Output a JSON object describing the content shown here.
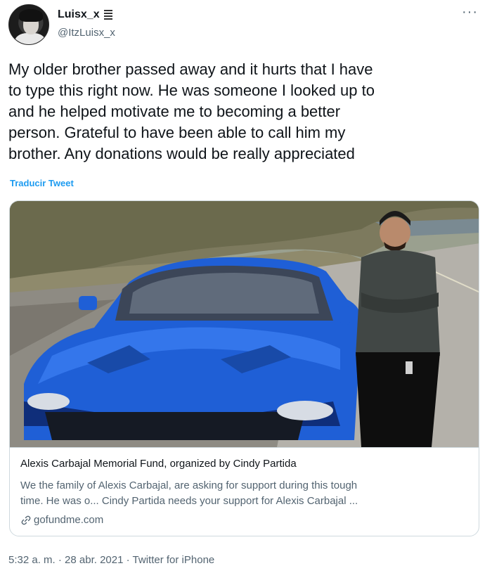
{
  "author": {
    "display_name": "Luisx_x",
    "handle": "@ItzLuisx_x"
  },
  "icons": {
    "more": "more-icon",
    "link": "link-icon"
  },
  "tweet": {
    "lines": [
      "My older brother passed away and it hurts that I have",
      "to type this right now. He was someone I looked up to",
      "and he helped motivate me to becoming a better",
      "person. Grateful to have been able to call him my",
      "brother. Any donations would be really appreciated"
    ],
    "translate_label": "Traducir Tweet"
  },
  "card": {
    "title": "Alexis Carbajal Memorial Fund, organized by Cindy Partida",
    "description_lines": [
      "We the family of Alexis Carbajal, are asking for support during this tough",
      "time. He was o... Cindy Partida needs your support for Alexis Carbajal ..."
    ],
    "domain": "gofundme.com"
  },
  "meta": {
    "time": "5:32 a. m.",
    "date": "28 abr. 2021",
    "source": "Twitter for iPhone",
    "separator": "·"
  },
  "colors": {
    "link": "#1d9bf0",
    "secondary_text": "#536471",
    "border": "#cfd9de",
    "car_blue": "#1f5fd6"
  }
}
